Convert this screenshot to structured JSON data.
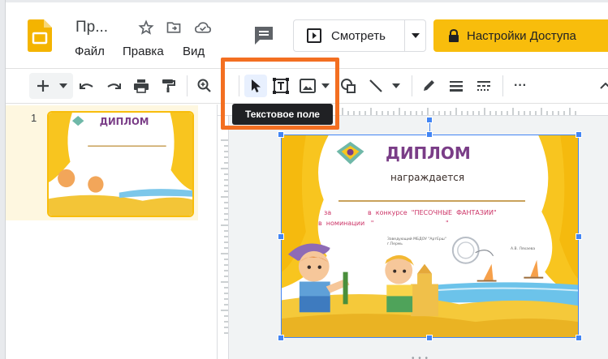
{
  "header": {
    "doc_title": "Пр...",
    "menu": [
      "Файл",
      "Правка",
      "Вид"
    ],
    "view_button_label": "Смотреть",
    "share_button_label": "Настройки Доступа"
  },
  "toolbar": {
    "tooltip": "Текстовое поле",
    "more_label": "···"
  },
  "filmstrip": {
    "slide_number": "1"
  },
  "slide": {
    "title": "ДИПЛОМ",
    "subtitle": "награждается",
    "line_za": "за",
    "line_contest": "в  конкурсе  \"ПЕСОЧНЫЕ  ФАНТАЗИИ\"",
    "line_nomination": "в  номинации   \"",
    "line_nomination_end": "\"",
    "footer_left": "Заведующий МБДОУ \"АртЕрш\" г.Пермь",
    "footer_right": "А.В. Ляхаева"
  },
  "colors": {
    "accent_yellow": "#f8bd0c",
    "highlight_orange": "#f36f21",
    "selection_blue": "#4285f4",
    "diploma_title": "#7a3d87"
  }
}
